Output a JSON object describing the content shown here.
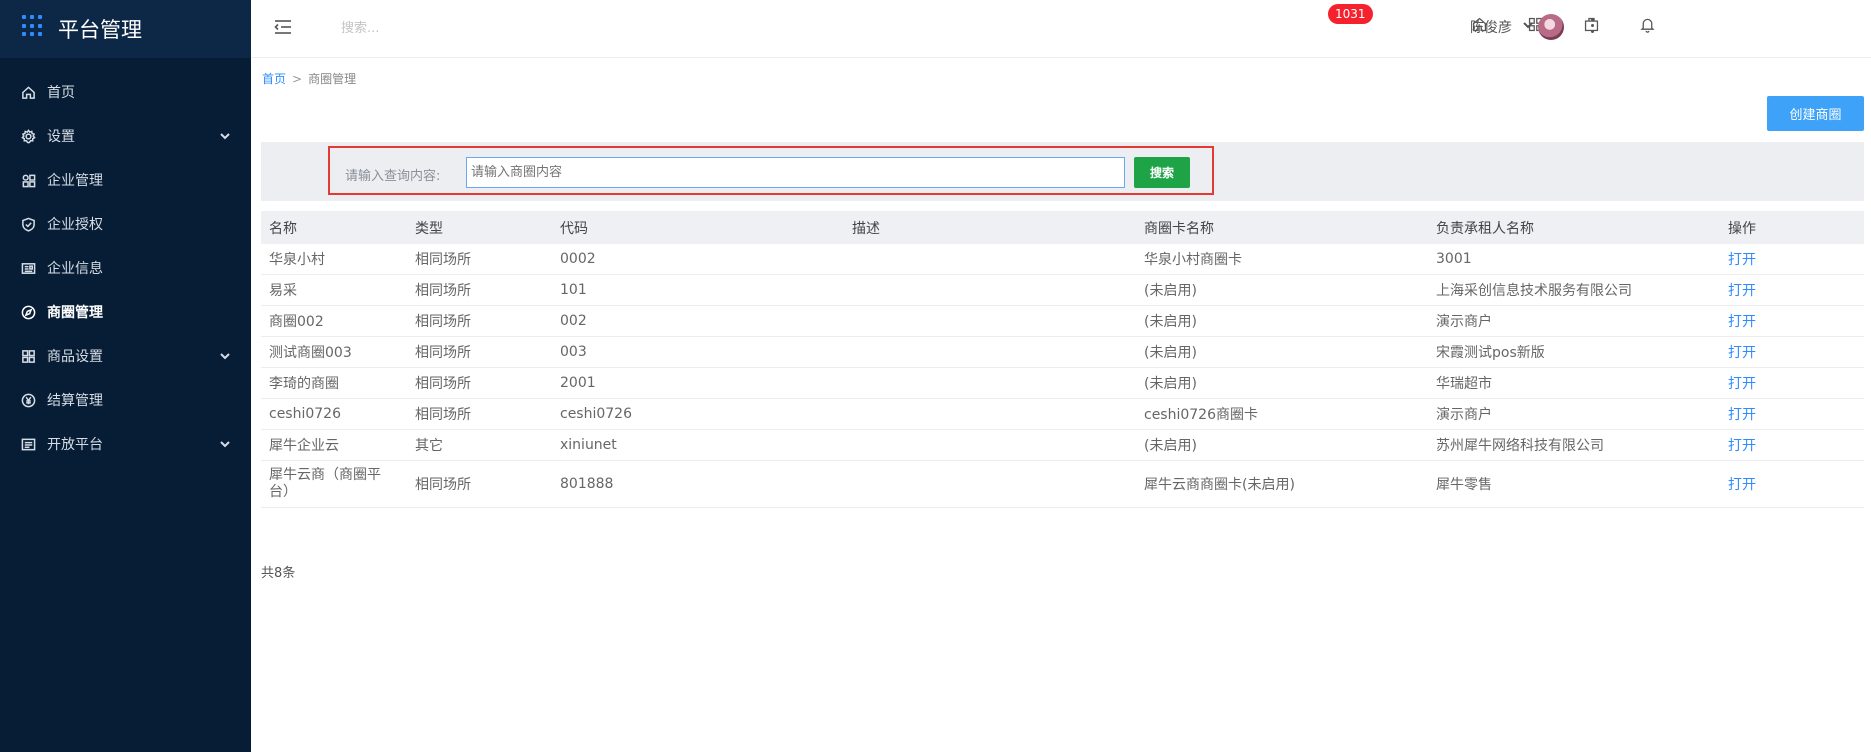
{
  "app": {
    "title": "平台管理"
  },
  "sidebar": {
    "items": [
      {
        "label": "首页",
        "icon": "home-icon",
        "expandable": false,
        "active": false
      },
      {
        "label": "设置",
        "icon": "gear-icon",
        "expandable": true,
        "active": false
      },
      {
        "label": "企业管理",
        "icon": "apps-icon",
        "expandable": false,
        "active": false
      },
      {
        "label": "企业授权",
        "icon": "shield-check-icon",
        "expandable": false,
        "active": false
      },
      {
        "label": "企业信息",
        "icon": "id-card-icon",
        "expandable": false,
        "active": false
      },
      {
        "label": "商圈管理",
        "icon": "compass-icon",
        "expandable": false,
        "active": true
      },
      {
        "label": "商品设置",
        "icon": "grid-icon",
        "expandable": true,
        "active": false
      },
      {
        "label": "结算管理",
        "icon": "yen-icon",
        "expandable": false,
        "active": false
      },
      {
        "label": "开放平台",
        "icon": "list-icon",
        "expandable": true,
        "active": false
      }
    ]
  },
  "header": {
    "search_placeholder": "搜索...",
    "badge_count": "1031",
    "user_name": "陈俊彦"
  },
  "breadcrumb": {
    "home": "首页",
    "separator": ">",
    "current": "商圈管理"
  },
  "toolbar": {
    "create_label": "创建商圈"
  },
  "filter": {
    "label": "请输入查询内容:",
    "input_placeholder": "请输入商圈内容",
    "search_label": "搜索"
  },
  "table": {
    "headers": [
      "名称",
      "类型",
      "代码",
      "描述",
      "商圈卡名称",
      "负责承租人名称",
      "操作"
    ],
    "rows": [
      {
        "name": "华泉小村",
        "type": "相同场所",
        "code": "0002",
        "desc": "",
        "card": "华泉小村商圈卡",
        "owner": "3001",
        "action": "打开"
      },
      {
        "name": "易采",
        "type": "相同场所",
        "code": "101",
        "desc": "",
        "card": "(未启用)",
        "owner": "上海采创信息技术服务有限公司",
        "action": "打开"
      },
      {
        "name": "商圈002",
        "type": "相同场所",
        "code": "002",
        "desc": "",
        "card": "(未启用)",
        "owner": "演示商户",
        "action": "打开"
      },
      {
        "name": "测试商圈003",
        "type": "相同场所",
        "code": "003",
        "desc": "",
        "card": "(未启用)",
        "owner": "宋霞测试pos新版",
        "action": "打开"
      },
      {
        "name": "李琦的商圈",
        "type": "相同场所",
        "code": "2001",
        "desc": "",
        "card": "(未启用)",
        "owner": "华瑞超市",
        "action": "打开"
      },
      {
        "name": "ceshi0726",
        "type": "相同场所",
        "code": "ceshi0726",
        "desc": "",
        "card": "ceshi0726商圈卡",
        "owner": "演示商户",
        "action": "打开"
      },
      {
        "name": "犀牛企业云",
        "type": "其它",
        "code": "xiniunet",
        "desc": "",
        "card": "(未启用)",
        "owner": "苏州犀牛网络科技有限公司",
        "action": "打开"
      },
      {
        "name": "犀牛云商（商圈平台）",
        "type": "相同场所",
        "code": "801888",
        "desc": "",
        "card": "犀牛云商商圈卡(未启用)",
        "owner": "犀牛零售",
        "action": "打开"
      }
    ],
    "total_label": "共8条"
  },
  "colors": {
    "sidebar_bg": "#071d35",
    "accent": "#2f8cff",
    "search_button": "#1ea446",
    "highlight_border": "#e53935",
    "badge": "#f5222d"
  }
}
